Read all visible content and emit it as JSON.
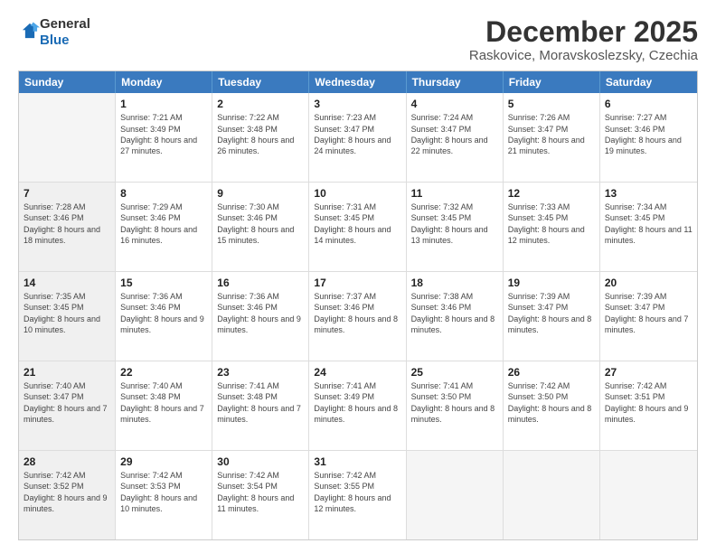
{
  "logo": {
    "general": "General",
    "blue": "Blue"
  },
  "header": {
    "month": "December 2025",
    "location": "Raskovice, Moravskoslezsky, Czechia"
  },
  "days": [
    "Sunday",
    "Monday",
    "Tuesday",
    "Wednesday",
    "Thursday",
    "Friday",
    "Saturday"
  ],
  "rows": [
    [
      {
        "day": "",
        "empty": true
      },
      {
        "day": "1",
        "sunrise": "Sunrise: 7:21 AM",
        "sunset": "Sunset: 3:49 PM",
        "daylight": "Daylight: 8 hours and 27 minutes."
      },
      {
        "day": "2",
        "sunrise": "Sunrise: 7:22 AM",
        "sunset": "Sunset: 3:48 PM",
        "daylight": "Daylight: 8 hours and 26 minutes."
      },
      {
        "day": "3",
        "sunrise": "Sunrise: 7:23 AM",
        "sunset": "Sunset: 3:47 PM",
        "daylight": "Daylight: 8 hours and 24 minutes."
      },
      {
        "day": "4",
        "sunrise": "Sunrise: 7:24 AM",
        "sunset": "Sunset: 3:47 PM",
        "daylight": "Daylight: 8 hours and 22 minutes."
      },
      {
        "day": "5",
        "sunrise": "Sunrise: 7:26 AM",
        "sunset": "Sunset: 3:47 PM",
        "daylight": "Daylight: 8 hours and 21 minutes."
      },
      {
        "day": "6",
        "sunrise": "Sunrise: 7:27 AM",
        "sunset": "Sunset: 3:46 PM",
        "daylight": "Daylight: 8 hours and 19 minutes."
      }
    ],
    [
      {
        "day": "7",
        "sunrise": "Sunrise: 7:28 AM",
        "sunset": "Sunset: 3:46 PM",
        "daylight": "Daylight: 8 hours and 18 minutes.",
        "shaded": true
      },
      {
        "day": "8",
        "sunrise": "Sunrise: 7:29 AM",
        "sunset": "Sunset: 3:46 PM",
        "daylight": "Daylight: 8 hours and 16 minutes."
      },
      {
        "day": "9",
        "sunrise": "Sunrise: 7:30 AM",
        "sunset": "Sunset: 3:46 PM",
        "daylight": "Daylight: 8 hours and 15 minutes."
      },
      {
        "day": "10",
        "sunrise": "Sunrise: 7:31 AM",
        "sunset": "Sunset: 3:45 PM",
        "daylight": "Daylight: 8 hours and 14 minutes."
      },
      {
        "day": "11",
        "sunrise": "Sunrise: 7:32 AM",
        "sunset": "Sunset: 3:45 PM",
        "daylight": "Daylight: 8 hours and 13 minutes."
      },
      {
        "day": "12",
        "sunrise": "Sunrise: 7:33 AM",
        "sunset": "Sunset: 3:45 PM",
        "daylight": "Daylight: 8 hours and 12 minutes."
      },
      {
        "day": "13",
        "sunrise": "Sunrise: 7:34 AM",
        "sunset": "Sunset: 3:45 PM",
        "daylight": "Daylight: 8 hours and 11 minutes."
      }
    ],
    [
      {
        "day": "14",
        "sunrise": "Sunrise: 7:35 AM",
        "sunset": "Sunset: 3:45 PM",
        "daylight": "Daylight: 8 hours and 10 minutes.",
        "shaded": true
      },
      {
        "day": "15",
        "sunrise": "Sunrise: 7:36 AM",
        "sunset": "Sunset: 3:46 PM",
        "daylight": "Daylight: 8 hours and 9 minutes."
      },
      {
        "day": "16",
        "sunrise": "Sunrise: 7:36 AM",
        "sunset": "Sunset: 3:46 PM",
        "daylight": "Daylight: 8 hours and 9 minutes."
      },
      {
        "day": "17",
        "sunrise": "Sunrise: 7:37 AM",
        "sunset": "Sunset: 3:46 PM",
        "daylight": "Daylight: 8 hours and 8 minutes."
      },
      {
        "day": "18",
        "sunrise": "Sunrise: 7:38 AM",
        "sunset": "Sunset: 3:46 PM",
        "daylight": "Daylight: 8 hours and 8 minutes."
      },
      {
        "day": "19",
        "sunrise": "Sunrise: 7:39 AM",
        "sunset": "Sunset: 3:47 PM",
        "daylight": "Daylight: 8 hours and 8 minutes."
      },
      {
        "day": "20",
        "sunrise": "Sunrise: 7:39 AM",
        "sunset": "Sunset: 3:47 PM",
        "daylight": "Daylight: 8 hours and 7 minutes."
      }
    ],
    [
      {
        "day": "21",
        "sunrise": "Sunrise: 7:40 AM",
        "sunset": "Sunset: 3:47 PM",
        "daylight": "Daylight: 8 hours and 7 minutes.",
        "shaded": true
      },
      {
        "day": "22",
        "sunrise": "Sunrise: 7:40 AM",
        "sunset": "Sunset: 3:48 PM",
        "daylight": "Daylight: 8 hours and 7 minutes."
      },
      {
        "day": "23",
        "sunrise": "Sunrise: 7:41 AM",
        "sunset": "Sunset: 3:48 PM",
        "daylight": "Daylight: 8 hours and 7 minutes."
      },
      {
        "day": "24",
        "sunrise": "Sunrise: 7:41 AM",
        "sunset": "Sunset: 3:49 PM",
        "daylight": "Daylight: 8 hours and 8 minutes."
      },
      {
        "day": "25",
        "sunrise": "Sunrise: 7:41 AM",
        "sunset": "Sunset: 3:50 PM",
        "daylight": "Daylight: 8 hours and 8 minutes."
      },
      {
        "day": "26",
        "sunrise": "Sunrise: 7:42 AM",
        "sunset": "Sunset: 3:50 PM",
        "daylight": "Daylight: 8 hours and 8 minutes."
      },
      {
        "day": "27",
        "sunrise": "Sunrise: 7:42 AM",
        "sunset": "Sunset: 3:51 PM",
        "daylight": "Daylight: 8 hours and 9 minutes."
      }
    ],
    [
      {
        "day": "28",
        "sunrise": "Sunrise: 7:42 AM",
        "sunset": "Sunset: 3:52 PM",
        "daylight": "Daylight: 8 hours and 9 minutes.",
        "shaded": true
      },
      {
        "day": "29",
        "sunrise": "Sunrise: 7:42 AM",
        "sunset": "Sunset: 3:53 PM",
        "daylight": "Daylight: 8 hours and 10 minutes."
      },
      {
        "day": "30",
        "sunrise": "Sunrise: 7:42 AM",
        "sunset": "Sunset: 3:54 PM",
        "daylight": "Daylight: 8 hours and 11 minutes."
      },
      {
        "day": "31",
        "sunrise": "Sunrise: 7:42 AM",
        "sunset": "Sunset: 3:55 PM",
        "daylight": "Daylight: 8 hours and 12 minutes."
      },
      {
        "day": "",
        "empty": true
      },
      {
        "day": "",
        "empty": true
      },
      {
        "day": "",
        "empty": true
      }
    ]
  ]
}
